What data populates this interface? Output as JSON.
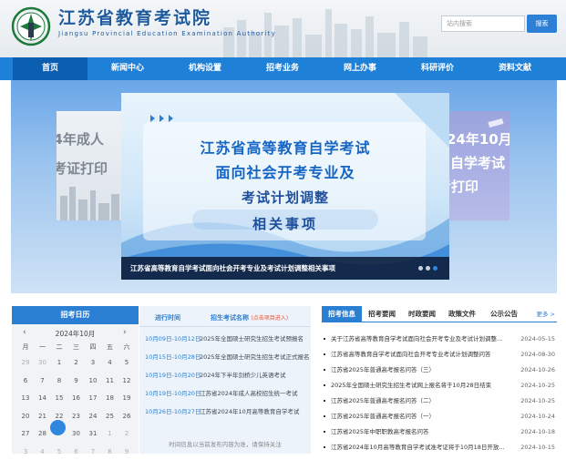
{
  "header": {
    "title": "江苏省教育考试院",
    "subtitle": "Jiangsu Provincial Education Examination Authority",
    "search": {
      "placeholder": "站内搜索",
      "button": "搜索"
    }
  },
  "nav": {
    "items": [
      {
        "label": "首页",
        "active": true
      },
      {
        "label": "新闻中心",
        "active": false
      },
      {
        "label": "机构设置",
        "active": false
      },
      {
        "label": "招考业务",
        "active": false
      },
      {
        "label": "网上办事",
        "active": false
      },
      {
        "label": "科研评价",
        "active": false
      },
      {
        "label": "资料文献",
        "active": false
      }
    ]
  },
  "hero": {
    "left_slide": {
      "line1": "24年成人",
      "line2": "考证打印"
    },
    "right_slide": {
      "line1": "24年10月",
      "line2": "自学考试",
      "line3": "考打印"
    },
    "main": {
      "lines": [
        "江苏省高等教育自学考试",
        "面向社会开考专业及",
        "考试计划调整",
        "相关事项"
      ],
      "caption": "江苏省高等教育自学考试面向社会开考专业及考试计划调整相关事项"
    },
    "dots": [
      false,
      false,
      true
    ]
  },
  "calendar": {
    "heading": "招考日历",
    "month_label": "2024年10月",
    "prev": "‹",
    "next": "›",
    "weekdays": [
      "一",
      "二",
      "三",
      "四",
      "五",
      "六",
      "日"
    ],
    "weekdays_display": [
      "月",
      "一",
      "二",
      "三",
      "四",
      "五",
      "六"
    ],
    "weeks": [
      [
        "29",
        "30",
        "1",
        "2",
        "3",
        "4",
        "5"
      ],
      [
        "6",
        "7",
        "8",
        "9",
        "10",
        "11",
        "12"
      ],
      [
        "13",
        "14",
        "15",
        "16",
        "17",
        "18",
        "19"
      ],
      [
        "20",
        "21",
        "22",
        "23",
        "24",
        "25",
        "26"
      ],
      [
        "27",
        "28",
        "29",
        "30",
        "31",
        "1",
        "2"
      ],
      [
        "3",
        "4",
        "5",
        "6",
        "7",
        "8",
        "9"
      ]
    ],
    "today": "29"
  },
  "schedule": {
    "col1": "进行时间",
    "col2": "招生考试名称",
    "col2_note": "(点击项目进入)",
    "rows": [
      {
        "date": "10月09日-10月12日",
        "title": "2025年全国硕士研究生招生考试预报名"
      },
      {
        "date": "10月15日-10月28日",
        "title": "2025年全国硕士研究生招生考试正式报名"
      },
      {
        "date": "10月19日-10月20日",
        "title": "2024年下半年剑桥少儿英语考试"
      },
      {
        "date": "10月19日-10月20日",
        "title": "江苏省2024年成人高校招生统一考试"
      },
      {
        "date": "10月26日-10月27日",
        "title": "江苏省2024年10月高等教育自学考试"
      }
    ],
    "footer": "时间信息以当前发布内容为准，请保持关注"
  },
  "news": {
    "tabs": [
      {
        "label": "招考信息",
        "active": true
      },
      {
        "label": "招考要闻",
        "active": false
      },
      {
        "label": "时政要闻",
        "active": false
      },
      {
        "label": "政策文件",
        "active": false
      },
      {
        "label": "公示公告",
        "active": false
      }
    ],
    "more": "更多 >",
    "items": [
      {
        "title": "关于江苏省高等教育自学考试面向社会开考专业及考试计划调整...",
        "date": "2024-05-15"
      },
      {
        "title": "江苏省高等教育自学考试面向社会开考专业考试计划调整问答",
        "date": "2024-08-30"
      },
      {
        "title": "江苏省2025年普通高考报名问答（三）",
        "date": "2024-10-26"
      },
      {
        "title": "2025年全国硕士研究生招生考试网上报名将于10月28日结束",
        "date": "2024-10-25"
      },
      {
        "title": "江苏省2025年普通高考报名问答（二）",
        "date": "2024-10-25"
      },
      {
        "title": "江苏省2025年普通高考报名问答（一）",
        "date": "2024-10-24"
      },
      {
        "title": "江苏省2025年中职职教高考报名问答",
        "date": "2024-10-18"
      },
      {
        "title": "江苏省2024年10月高等教育自学考试准考证将于10月18日开放...",
        "date": "2024-10-15"
      }
    ]
  }
}
